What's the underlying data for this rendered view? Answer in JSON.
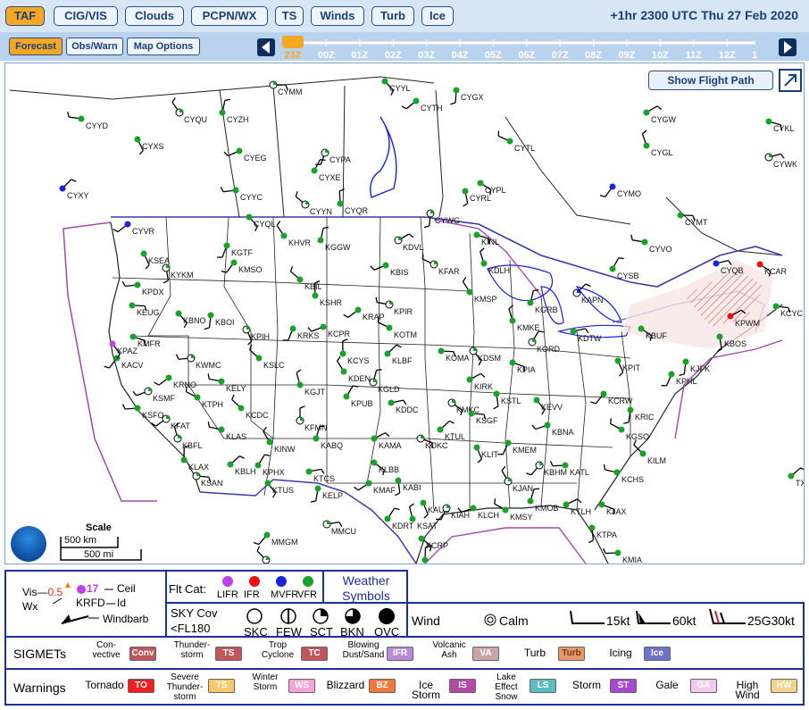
{
  "tabs": [
    "TAF",
    "CIG/VIS",
    "Clouds",
    "PCPN/WX",
    "TS",
    "Winds",
    "Turb",
    "Ice"
  ],
  "datetime": "+1hr 2300 UTC Thu 27 Feb 2020",
  "mode_buttons": {
    "forecast": "Forecast",
    "obs_warn": "Obs/Warn",
    "map_options": "Map Options"
  },
  "timeline": {
    "hours": [
      "23Z",
      "00Z",
      "01Z",
      "02Z",
      "03Z",
      "04Z",
      "05Z",
      "06Z",
      "07Z",
      "08Z",
      "09Z",
      "10Z",
      "11Z",
      "12Z",
      "13Z"
    ],
    "selected": "23Z"
  },
  "map": {
    "show_flight_path": "Show Flight Path",
    "scale": {
      "title": "Scale",
      "km": "500 km",
      "mi": "500 mi"
    },
    "stations": [
      [
        "CYMM",
        300,
        24,
        "g"
      ],
      [
        "CYYL",
        425,
        20,
        "g"
      ],
      [
        "CYGX",
        505,
        30,
        "g"
      ],
      [
        "CYTH",
        460,
        42,
        "g"
      ],
      [
        "CYYD",
        85,
        62,
        "g"
      ],
      [
        "CYQU",
        195,
        55,
        "g"
      ],
      [
        "CYZH",
        243,
        55,
        "g"
      ],
      [
        "CYGW",
        718,
        55,
        "g"
      ],
      [
        "CYKL",
        855,
        65,
        "g"
      ],
      [
        "CYXS",
        148,
        85,
        "g"
      ],
      [
        "CYPA",
        358,
        100,
        "g"
      ],
      [
        "CYEG",
        262,
        98,
        "g"
      ],
      [
        "CYTL",
        565,
        87,
        "g"
      ],
      [
        "CYGL",
        718,
        92,
        "g"
      ],
      [
        "CYXE",
        346,
        120,
        "g"
      ],
      [
        "CYWK",
        855,
        105,
        "g"
      ],
      [
        "CYPL",
        532,
        134,
        "g"
      ],
      [
        "CYRL",
        515,
        143,
        "g"
      ],
      [
        "CYMO",
        680,
        138,
        "b"
      ],
      [
        "CYYC",
        258,
        142,
        "g"
      ],
      [
        "CYYN",
        336,
        158,
        "g"
      ],
      [
        "CYQR",
        375,
        157,
        "g"
      ],
      [
        "CYXY",
        64,
        140,
        "b"
      ],
      [
        "CYMT",
        756,
        170,
        "g"
      ],
      [
        "CYQL",
        273,
        172,
        "g"
      ],
      [
        "CYWG",
        476,
        168,
        "g"
      ],
      [
        "CYVR",
        137,
        180,
        "b"
      ],
      [
        "CYVO",
        716,
        200,
        "g"
      ],
      [
        "KHVR",
        312,
        193,
        "g"
      ],
      [
        "KGGW",
        353,
        198,
        "g"
      ],
      [
        "KDVL",
        440,
        198,
        "g"
      ],
      [
        "KINL",
        528,
        192,
        "g"
      ],
      [
        "KSEA",
        155,
        213,
        "g"
      ],
      [
        "KGTF",
        248,
        204,
        "g"
      ],
      [
        "KBIS",
        426,
        226,
        "g"
      ],
      [
        "KFAR",
        480,
        225,
        "g"
      ],
      [
        "KDLH",
        536,
        224,
        "g"
      ],
      [
        "CYSB",
        680,
        230,
        "g"
      ],
      [
        "CYQB",
        796,
        224,
        "b"
      ],
      [
        "KCAR",
        845,
        225,
        "r"
      ],
      [
        "KYKM",
        180,
        229,
        "g"
      ],
      [
        "KMSO",
        256,
        223,
        "g"
      ],
      [
        "KPDX",
        148,
        248,
        "g"
      ],
      [
        "KBIL",
        330,
        242,
        "g"
      ],
      [
        "KSHR",
        347,
        260,
        "g"
      ],
      [
        "KAPN",
        640,
        257,
        "b"
      ],
      [
        "KEUG",
        142,
        271,
        "g"
      ],
      [
        "KBNO",
        194,
        280,
        "g"
      ],
      [
        "KBOI",
        230,
        282,
        "g"
      ],
      [
        "KRAP",
        395,
        276,
        "g"
      ],
      [
        "KPIR",
        430,
        270,
        "g"
      ],
      [
        "KMSP",
        520,
        256,
        "g"
      ],
      [
        "KGRB",
        588,
        268,
        "g"
      ],
      [
        "KPWM",
        812,
        283,
        "r"
      ],
      [
        "KMFR",
        143,
        306,
        "g"
      ],
      [
        "KPIH",
        270,
        298,
        "g"
      ],
      [
        "KRKS",
        322,
        297,
        "g"
      ],
      [
        "KCPR",
        356,
        295,
        "g"
      ],
      [
        "KOTM",
        430,
        296,
        "g"
      ],
      [
        "KMKE",
        568,
        288,
        "g"
      ],
      [
        "KORD",
        590,
        312,
        "g"
      ],
      [
        "KDTW",
        636,
        300,
        "g"
      ],
      [
        "KBUF",
        712,
        297,
        "g"
      ],
      [
        "KBOS",
        800,
        306,
        "g"
      ],
      [
        "KACV",
        125,
        330,
        "g"
      ],
      [
        "KWMC",
        208,
        330,
        "g"
      ],
      [
        "KSLC",
        284,
        330,
        "g"
      ],
      [
        "KCYS",
        378,
        325,
        "g"
      ],
      [
        "KLBF",
        428,
        325,
        "g"
      ],
      [
        "KOMA",
        488,
        322,
        "g"
      ],
      [
        "KDSM",
        524,
        322,
        "g"
      ],
      [
        "KJFK",
        762,
        334,
        "g"
      ],
      [
        "KRNO",
        183,
        352,
        "g"
      ],
      [
        "KELY",
        242,
        356,
        "g"
      ],
      [
        "KDEN",
        379,
        345,
        "g"
      ],
      [
        "KGLD",
        412,
        357,
        "g"
      ],
      [
        "KIRK",
        520,
        354,
        "g"
      ],
      [
        "KPIA",
        568,
        335,
        "g"
      ],
      [
        "KPIT",
        686,
        333,
        "g"
      ],
      [
        "KPHL",
        746,
        348,
        "g"
      ],
      [
        "KSMF",
        160,
        367,
        "g"
      ],
      [
        "KTPH",
        215,
        374,
        "g"
      ],
      [
        "KGJT",
        330,
        360,
        "g"
      ],
      [
        "KPUB",
        382,
        373,
        "g"
      ],
      [
        "KDDC",
        432,
        380,
        "g"
      ],
      [
        "KMKC",
        500,
        380,
        "g"
      ],
      [
        "KSTL",
        550,
        370,
        "g"
      ],
      [
        "KCRW",
        670,
        370,
        "g"
      ],
      [
        "KSFO",
        148,
        386,
        "g"
      ],
      [
        "KCDC",
        264,
        386,
        "g"
      ],
      [
        "KFMN",
        330,
        400,
        "g"
      ],
      [
        "KTUL",
        487,
        410,
        "g"
      ],
      [
        "KSGF",
        522,
        392,
        "g"
      ],
      [
        "KEVV",
        595,
        377,
        "g"
      ],
      [
        "KRIC",
        700,
        388,
        "g"
      ],
      [
        "KFAT",
        180,
        398,
        "g"
      ],
      [
        "KLAS",
        242,
        410,
        "g"
      ],
      [
        "KINW",
        296,
        424,
        "g"
      ],
      [
        "KABQ",
        348,
        420,
        "g"
      ],
      [
        "KAMA",
        413,
        420,
        "g"
      ],
      [
        "KOKC",
        465,
        420,
        "g"
      ],
      [
        "KLIT",
        528,
        430,
        "g"
      ],
      [
        "KMEM",
        563,
        425,
        "g"
      ],
      [
        "KBNA",
        607,
        405,
        "g"
      ],
      [
        "KGSO",
        690,
        410,
        "g"
      ],
      [
        "KBFL",
        193,
        420,
        "g"
      ],
      [
        "KPHX",
        283,
        450,
        "g"
      ],
      [
        "KTCS",
        340,
        457,
        "g"
      ],
      [
        "KLBB",
        413,
        447,
        "g"
      ],
      [
        "KABI",
        440,
        467,
        "g"
      ],
      [
        "KBHM",
        598,
        450,
        "g"
      ],
      [
        "KATL",
        627,
        450,
        "g"
      ],
      [
        "KILM",
        714,
        437,
        "g"
      ],
      [
        "KLAX",
        200,
        444,
        "g"
      ],
      [
        "KBLH",
        252,
        449,
        "g"
      ],
      [
        "KSAN",
        214,
        462,
        "g"
      ],
      [
        "KTUS",
        294,
        470,
        "g"
      ],
      [
        "KELP",
        350,
        476,
        "g"
      ],
      [
        "KMAF",
        407,
        470,
        "g"
      ],
      [
        "KCHS",
        685,
        458,
        "g"
      ],
      [
        "KJAN",
        563,
        468,
        "g"
      ],
      [
        "KMOB",
        588,
        490,
        "g"
      ],
      [
        "KTLH",
        628,
        494,
        "g"
      ],
      [
        "KJAX",
        668,
        494,
        "g"
      ],
      [
        "KAUS",
        468,
        492,
        "g"
      ],
      [
        "KIAH",
        494,
        498,
        "g"
      ],
      [
        "KLCH",
        524,
        498,
        "g"
      ],
      [
        "KMSY",
        560,
        500,
        "g"
      ],
      [
        "KSAT",
        456,
        510,
        "g"
      ],
      [
        "KDRT",
        428,
        510,
        "g"
      ],
      [
        "MMCU",
        360,
        516,
        "g"
      ],
      [
        "KCRP",
        466,
        532,
        "g"
      ],
      [
        "KTPA",
        657,
        520,
        "g"
      ],
      [
        "MMGM",
        293,
        528,
        "g"
      ],
      [
        "KMIA",
        686,
        548,
        "g"
      ],
      [
        "MMLT",
        292,
        556,
        "g"
      ],
      [
        "KBRO",
        470,
        556,
        "g"
      ],
      [
        "TXKF",
        880,
        462,
        "g"
      ],
      [
        "KCYC",
        863,
        272,
        "g"
      ],
      [
        "KPAZ",
        120,
        314,
        "m"
      ]
    ]
  },
  "legend": {
    "vis_label": "Vis",
    "vis_value": "0.5",
    "wx_label": "Wx",
    "ceil_value": "17",
    "ceil_label": "Ceil",
    "id_value": "KRFD",
    "id_label": "Id",
    "windbarb_label": "Windbarb",
    "flt_cat": {
      "title": "Flt Cat:",
      "items": [
        [
          "LIFR",
          "#c040ee"
        ],
        [
          "IFR",
          "#ee1010"
        ],
        [
          "MVFR",
          "#1a22dd"
        ],
        [
          "VFR",
          "#17a32a"
        ]
      ]
    },
    "weather_symbols": "Weather Symbols",
    "sky_cov": {
      "title1": "SKY Cov",
      "title2": "<FL180",
      "items": [
        "SKC",
        "FEW",
        "SCT",
        "BKN",
        "OVC"
      ]
    },
    "wind": {
      "title": "Wind",
      "calm": "Calm",
      "kt15": "15kt",
      "kt60": "60kt",
      "gust": "25G30kt"
    },
    "sigmets": {
      "title": "SIGMETs",
      "items": [
        [
          "Con-vective",
          "Conv",
          "#c0565a",
          "#ffffff"
        ],
        [
          "Thunder-storm",
          "TS",
          "#c0565a",
          "#ffffff"
        ],
        [
          "Trop Cyclone",
          "TC",
          "#c0565a",
          "#ffffff"
        ],
        [
          "Blowing Dust/Sand",
          "IFR",
          "#b98ad6",
          "#ffffff"
        ],
        [
          "Volcanic Ash",
          "VA",
          "#c9a5a6",
          "#ffffff"
        ],
        [
          "Turb",
          "Turb",
          "#e59a6e",
          "#7a3a10"
        ],
        [
          "Icing",
          "Ice",
          "#6f72c9",
          "#ffffff"
        ]
      ]
    },
    "warnings": {
      "title": "Warnings",
      "items": [
        [
          "Tornado",
          "TO",
          "#ee2020",
          "#ffffff"
        ],
        [
          "Severe Thunder-storm",
          "TS",
          "#f6c86a",
          "#ffffff"
        ],
        [
          "Winter Storm",
          "WS",
          "#f6a3d6",
          "#ffffff"
        ],
        [
          "Blizzard",
          "BZ",
          "#f07a3a",
          "#ffffff"
        ],
        [
          "Ice Storm",
          "IS",
          "#b34aa6",
          "#ffffff"
        ],
        [
          "Lake Effect Snow",
          "LS",
          "#5bbcc0",
          "#ffffff"
        ],
        [
          "Storm",
          "ST",
          "#a84ad0",
          "#ffffff"
        ],
        [
          "Gale",
          "GA",
          "#f3c8ee",
          "#ffffff"
        ],
        [
          "High Wind",
          "HW",
          "#f4d28a",
          "#ffffff"
        ]
      ]
    }
  }
}
